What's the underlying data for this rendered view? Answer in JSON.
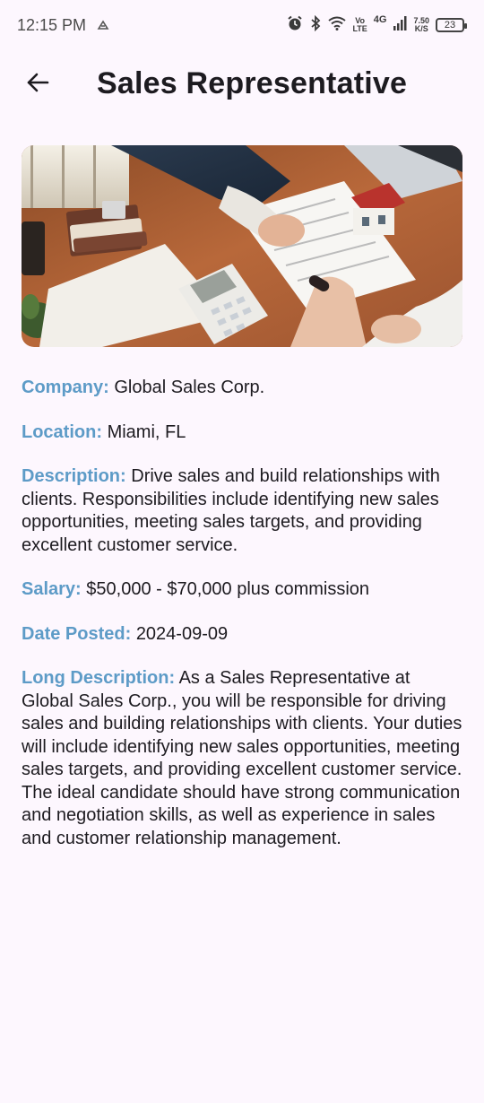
{
  "status_bar": {
    "time": "12:15 PM",
    "vo_lte_top": "Vo",
    "vo_lte_bottom": "LTE",
    "network": "4G",
    "speed_top": "7.50",
    "speed_bottom": "K/S",
    "battery": "23"
  },
  "app_bar": {
    "title": "Sales Representative"
  },
  "job": {
    "company_label": "Company:",
    "company": "Global Sales Corp.",
    "location_label": "Location:",
    "location": "Miami, FL",
    "description_label": "Description:",
    "description": "Drive sales and build relationships with clients. Responsibilities include identifying new sales opportunities, meeting sales targets, and providing excellent customer service.",
    "salary_label": "Salary:",
    "salary": "$50,000 - $70,000 plus commission",
    "date_label": "Date Posted:",
    "date": "2024-09-09",
    "long_description_label": "Long Description:",
    "long_description": "As a Sales Representative at Global Sales Corp., you will be responsible for driving sales and building relationships with clients. Your duties will include identifying new sales opportunities, meeting sales targets, and providing excellent customer service. The ideal candidate should have strong communication and negotiation skills, as well as experience in sales and customer relationship management."
  },
  "icons": {
    "back": "arrow-back-icon",
    "alarm": "alarm-icon",
    "bluetooth": "bluetooth-icon",
    "wifi": "wifi-icon",
    "signal": "signal-icon",
    "notification": "notification-icon"
  }
}
